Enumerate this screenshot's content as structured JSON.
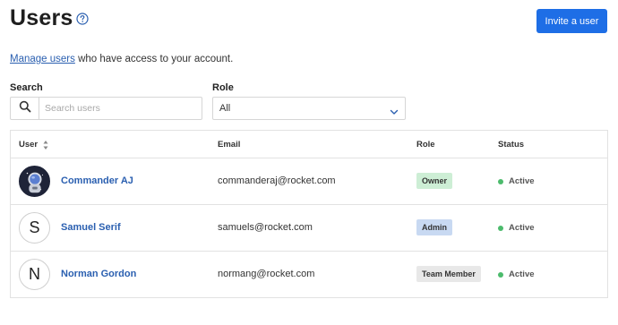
{
  "header": {
    "title": "Users",
    "invite_label": "Invite a user"
  },
  "description": {
    "link_text": "Manage users",
    "rest_text": " who have access to your account."
  },
  "filters": {
    "search_label": "Search",
    "search_placeholder": "Search users",
    "role_label": "Role",
    "role_value": "All"
  },
  "table": {
    "columns": [
      "User",
      "Email",
      "Role",
      "Status"
    ],
    "rows": [
      {
        "avatar_letter": "",
        "avatar_type": "image",
        "name": "Commander AJ",
        "email": "commanderaj@rocket.com",
        "role": "Owner",
        "role_color": "#cdeed5",
        "status": "Active"
      },
      {
        "avatar_letter": "S",
        "avatar_type": "letter",
        "name": "Samuel Serif",
        "email": "samuels@rocket.com",
        "role": "Admin",
        "role_color": "#c8d9f2",
        "status": "Active"
      },
      {
        "avatar_letter": "N",
        "avatar_type": "letter",
        "name": "Norman Gordon",
        "email": "normang@rocket.com",
        "role": "Team Member",
        "role_color": "#e8e8e8",
        "status": "Active"
      }
    ]
  },
  "colors": {
    "accent": "#1e6ee6",
    "link": "#2a5fb0",
    "status_active": "#4cbb6c"
  }
}
